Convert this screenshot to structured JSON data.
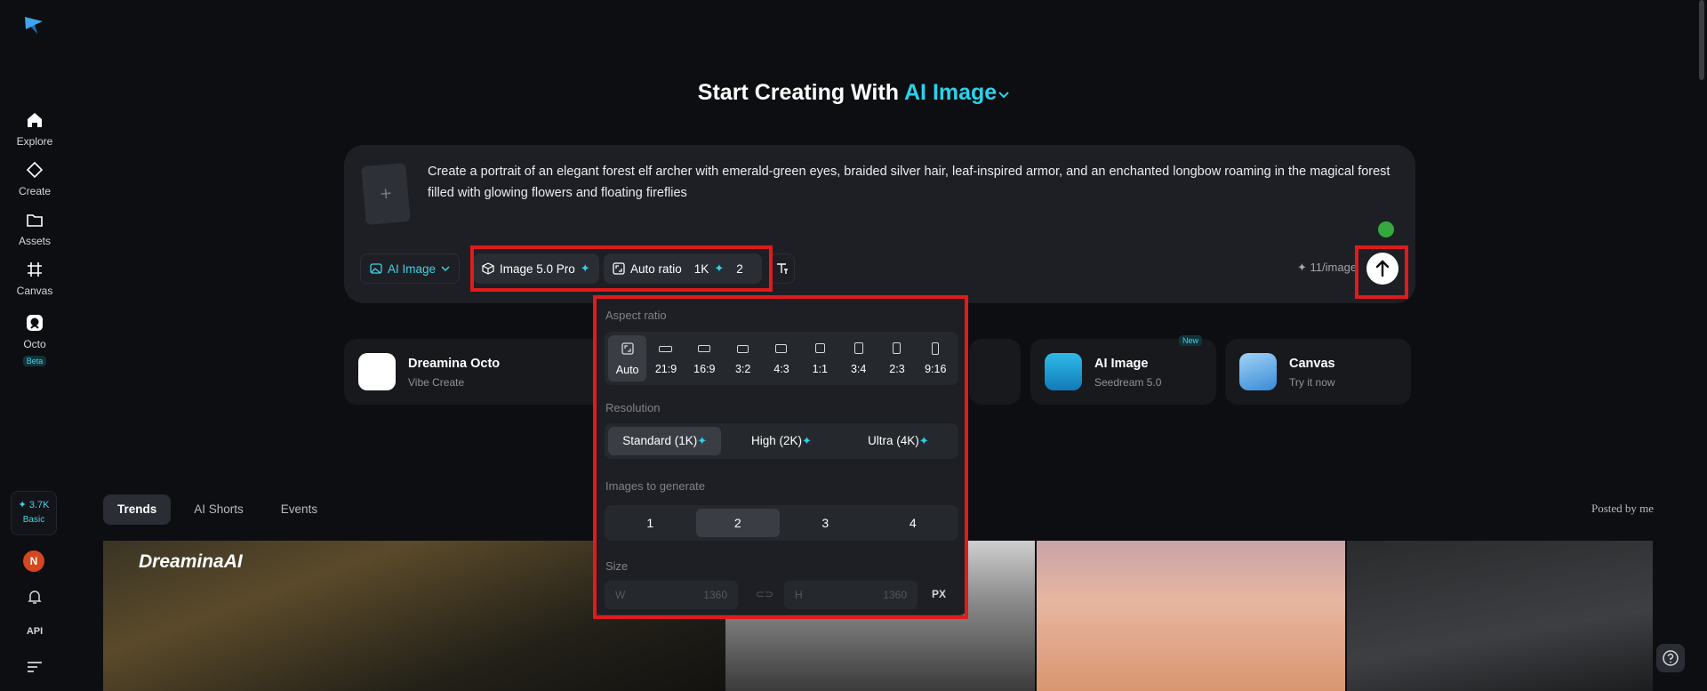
{
  "sidebar": {
    "logo_icon": "dreamina-logo",
    "items": [
      {
        "label": "Explore",
        "icon": "home-icon"
      },
      {
        "label": "Create",
        "icon": "diamond-icon"
      },
      {
        "label": "Assets",
        "icon": "folder-icon"
      },
      {
        "label": "Canvas",
        "icon": "canvas-icon"
      },
      {
        "label": "Octo",
        "icon": "octo-icon",
        "badge": "Beta"
      }
    ],
    "credits": {
      "value": "3.7K",
      "plan": "Basic"
    },
    "avatar_initial": "N",
    "api_label": "API"
  },
  "heading": {
    "prefix": "Start Creating With",
    "mode": "AI Image"
  },
  "prompt": {
    "text": "Create a portrait of an elegant forest elf archer with emerald-green eyes, braided silver hair, leaf-inspired armor, and an enchanted longbow roaming in the magical forest filled with glowing flowers and floating fireflies",
    "add_symbol": "+"
  },
  "toolbar": {
    "mode_label": "AI Image",
    "model_label": "Image 5.0 Pro",
    "ratio_label": "Auto ratio",
    "resolution_label": "1K",
    "count_label": "2",
    "cost_label": "11/image"
  },
  "quick_cards": [
    {
      "title": "Dreamina Octo",
      "subtitle": "Vibe Create",
      "tag": ""
    },
    {
      "title": "AI Image",
      "subtitle": "Seedream 5.0",
      "tag": "New"
    },
    {
      "title": "Canvas",
      "subtitle": "Try it now",
      "tag": ""
    }
  ],
  "tabs": [
    "Trends",
    "AI Shorts",
    "Events"
  ],
  "posted_by": "Posted by me",
  "gallery": {
    "watermark": "DreaminaAI"
  },
  "popover": {
    "aspect_label": "Aspect ratio",
    "ratios": [
      "Auto",
      "21:9",
      "16:9",
      "3:2",
      "4:3",
      "1:1",
      "3:4",
      "2:3",
      "9:16"
    ],
    "selected_ratio": "Auto",
    "resolution_label": "Resolution",
    "resolutions": [
      "Standard (1K)",
      "High (2K)",
      "Ultra (4K)"
    ],
    "selected_resolution": "Standard (1K)",
    "count_label": "Images to generate",
    "counts": [
      "1",
      "2",
      "3",
      "4"
    ],
    "selected_count": "2",
    "size_label": "Size",
    "width_prefix": "W",
    "width_value": "1360",
    "height_prefix": "H",
    "height_value": "1360",
    "unit": "PX"
  },
  "colors": {
    "accent": "#2bd2ec",
    "highlight": "#e01b1b",
    "background": "#0d0e11"
  }
}
